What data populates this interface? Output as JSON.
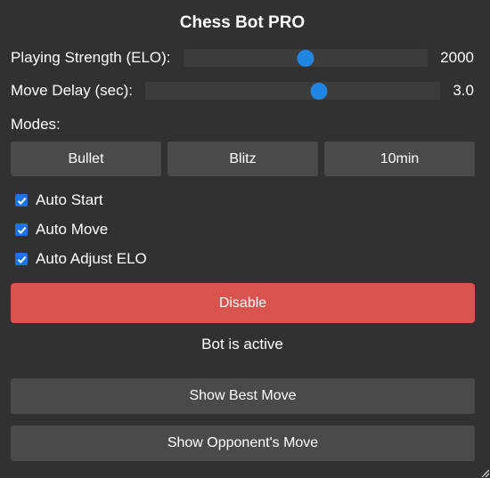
{
  "title": "Chess Bot PRO",
  "strength": {
    "label": "Playing Strength (ELO):",
    "value": "2000",
    "level_fraction": 0.5
  },
  "delay": {
    "label": "Move Delay (sec):",
    "value": "3.0",
    "level_fraction": 0.59
  },
  "modes": {
    "label": "Modes:",
    "buttons": [
      "Bullet",
      "Blitz",
      "10min"
    ]
  },
  "options": [
    {
      "label": "Auto Start",
      "checked": true
    },
    {
      "label": "Auto Move",
      "checked": true
    },
    {
      "label": "Auto Adjust ELO",
      "checked": true
    }
  ],
  "toggle_button": "Disable",
  "status": "Bot is active",
  "actions": {
    "best_move": "Show Best Move",
    "opponent_move": "Show Opponent's Move"
  },
  "colors": {
    "background": "#313131",
    "button": "#4a4a4a",
    "slider_track": "#3c3c3c",
    "accent": "#1f86e3",
    "disable": "#d9534f",
    "text": "#ffffff"
  },
  "icons": {
    "checkbox": "check-icon",
    "corner": "resize-grip-icon"
  }
}
